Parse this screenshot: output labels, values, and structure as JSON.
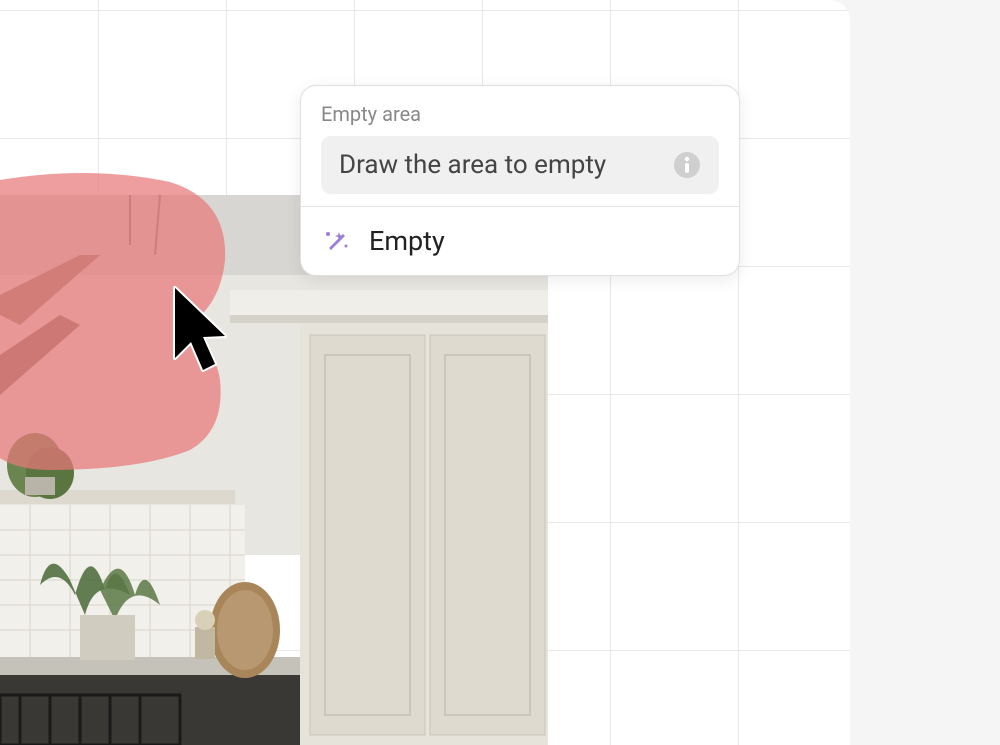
{
  "popup": {
    "section_label": "Empty area",
    "instruction_text": "Draw the area to empty",
    "action_label": "Empty"
  },
  "icons": {
    "info": "info-icon",
    "wand": "magic-wand-icon",
    "cursor": "cursor-pointer"
  },
  "colors": {
    "mask_red": "#e87878",
    "wand_purple": "#9b7fd6",
    "text_gray": "#888888",
    "text_dark": "#444444"
  }
}
